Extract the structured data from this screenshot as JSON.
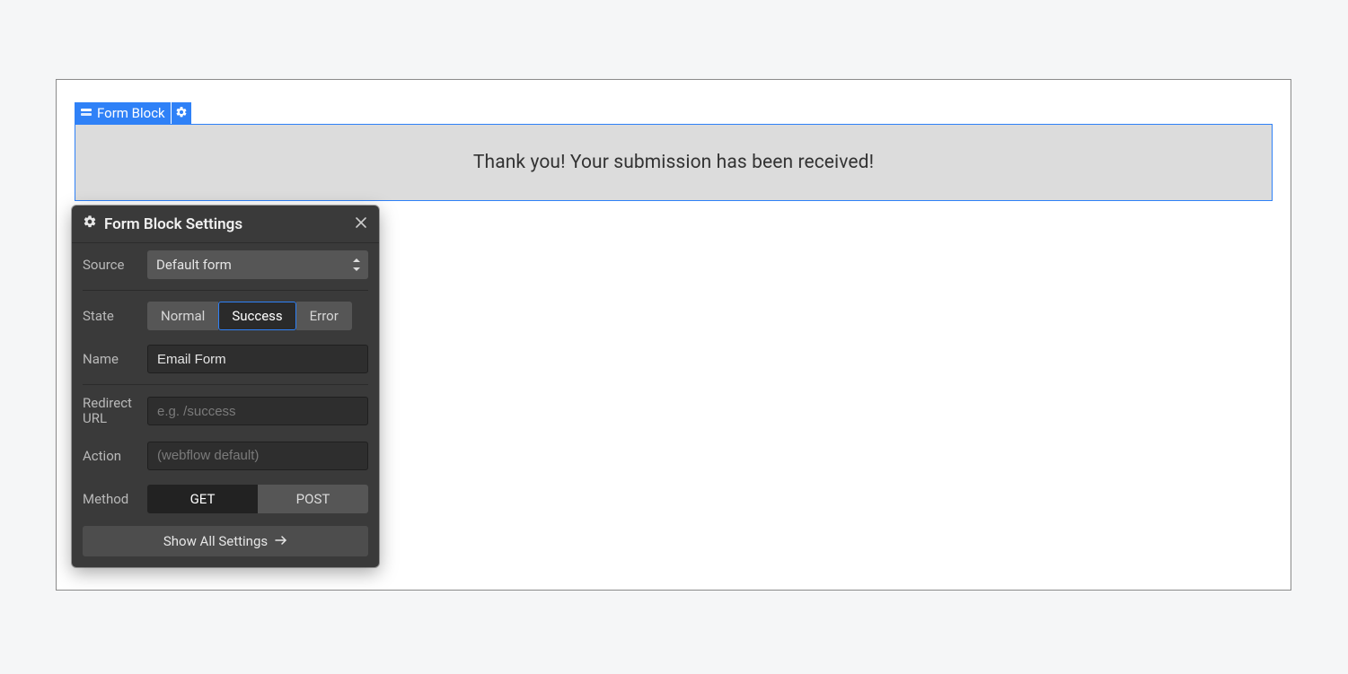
{
  "element_tag": {
    "label": "Form Block"
  },
  "form_success_message": "Thank you! Your submission has been received!",
  "settings_panel": {
    "title": "Form Block Settings",
    "source": {
      "label": "Source",
      "value": "Default form"
    },
    "state": {
      "label": "State",
      "options": [
        "Normal",
        "Success",
        "Error"
      ],
      "selected": "Success"
    },
    "name": {
      "label": "Name",
      "value": "Email Form"
    },
    "redirect_url": {
      "label": "Redirect URL",
      "placeholder": "e.g. /success",
      "value": ""
    },
    "action": {
      "label": "Action",
      "placeholder": "(webflow default)",
      "value": ""
    },
    "method": {
      "label": "Method",
      "options": [
        "GET",
        "POST"
      ],
      "selected": "GET"
    },
    "show_all_label": "Show All Settings"
  }
}
